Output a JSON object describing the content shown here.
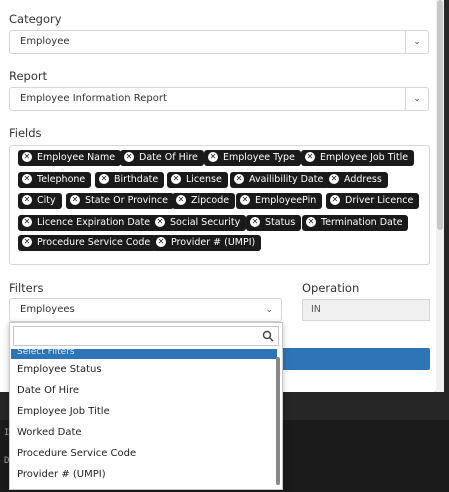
{
  "form": {
    "category": {
      "label": "Category",
      "value": "Employee"
    },
    "report": {
      "label": "Report",
      "value": "Employee Information Report"
    },
    "fields": {
      "label": "Fields",
      "chips": [
        "Employee Name",
        "Date Of Hire",
        "Employee Type",
        "Employee Job Title",
        "Telephone",
        "Birthdate",
        "License",
        "Availibility Date",
        "Address",
        "City",
        "State Or Province",
        "Zipcode",
        "EmployeePin",
        "Driver Licence",
        "Licence Expiration Date",
        "Social Security",
        "Status",
        "Termination Date",
        "Procedure Service Code",
        "Provider # (UMPI)"
      ]
    },
    "filters": {
      "label": "Filters",
      "value": "Employees"
    },
    "operation": {
      "label": "Operation",
      "value": "IN"
    }
  },
  "dropdown": {
    "search_value": "",
    "selected_item": "Select Filters",
    "items": [
      "Employee Status",
      "Date Of Hire",
      "Employee Job Title",
      "Worked Date",
      "Procedure Service Code",
      "Provider # (UMPI)"
    ]
  },
  "colors": {
    "accent": "#2d75b6",
    "chip_bg": "#1a1a1a"
  },
  "icons": {
    "chip_remove": "close-circle-icon",
    "select_caret": "chevron-down-icon",
    "search": "search-icon"
  }
}
